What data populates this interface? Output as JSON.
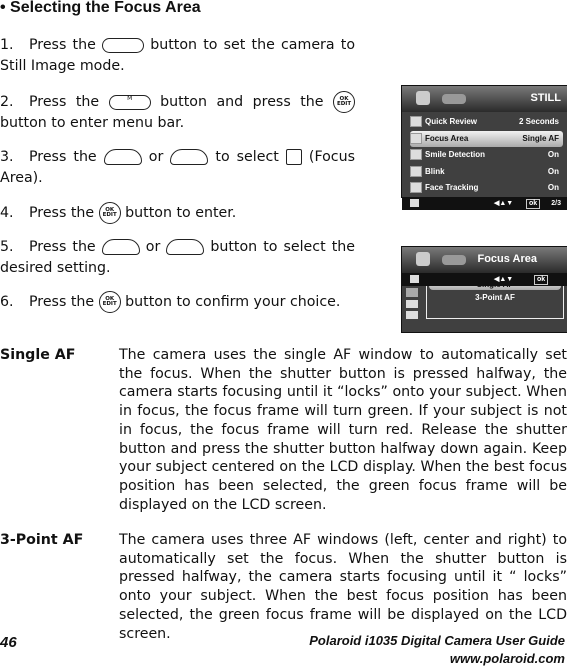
{
  "title": "• Selecting the Focus Area",
  "steps": [
    {
      "num": "1.",
      "parts": [
        "Press the",
        "button to set the camera to Still Image mode."
      ]
    },
    {
      "num": "2.",
      "parts": [
        "Press the",
        "button and press the",
        "button to enter menu bar."
      ]
    },
    {
      "num": "3.",
      "parts": [
        "Press the",
        "or",
        "to select",
        "(Focus Area)."
      ]
    },
    {
      "num": "4.",
      "parts": [
        "Press the",
        "button to enter."
      ]
    },
    {
      "num": "5.",
      "parts": [
        "Press the",
        "or",
        "button to select the desired setting."
      ]
    },
    {
      "num": "6.",
      "parts": [
        "Press the",
        "button to confirm your choice."
      ]
    }
  ],
  "icons": {
    "mode": "MODE",
    "menu": "M",
    "ok": "OK",
    "edit": "EDIT"
  },
  "screen1": {
    "title": "STILL",
    "rows": [
      {
        "label": "Quick Review",
        "value": "2 Seconds"
      },
      {
        "label": "Focus Area",
        "value": "Single AF",
        "selected": true
      },
      {
        "label": "Smile Detection",
        "value": "On"
      },
      {
        "label": "Blink",
        "value": "On"
      },
      {
        "label": "Face Tracking",
        "value": "On"
      }
    ],
    "footer_nav": "◀▲▼",
    "footer_ok": "ok",
    "page": "2/3"
  },
  "screen2": {
    "title": "Focus Area",
    "options": [
      "Single AF",
      "3-Point AF"
    ],
    "footer_nav": "◀▲▼",
    "footer_ok": "ok"
  },
  "definitions": [
    {
      "term": "Single AF",
      "text": "The camera uses the single AF window to automatically set the focus. When the shutter button is pressed halfway, the camera starts focusing until it “locks” onto your subject. When in focus, the focus frame will turn green. If your subject is not in focus, the focus frame will turn red. Release the shutter button and press the shutter button halfway down again. Keep your subject centered on the LCD display. When the best focus position has been selected, the green focus frame will be displayed on the LCD screen."
    },
    {
      "term": "3-Point AF",
      "text": "The camera uses three AF windows (left, center and right) to automatically set the focus. When the shutter button is pressed halfway, the camera starts focusing until it “ locks” onto your subject. When the best focus position has been selected, the green focus frame will be displayed on the LCD screen."
    }
  ],
  "footer": {
    "page_number": "46",
    "guide": "Polaroid i1035 Digital Camera User Guide",
    "url": "www.polaroid.com"
  }
}
